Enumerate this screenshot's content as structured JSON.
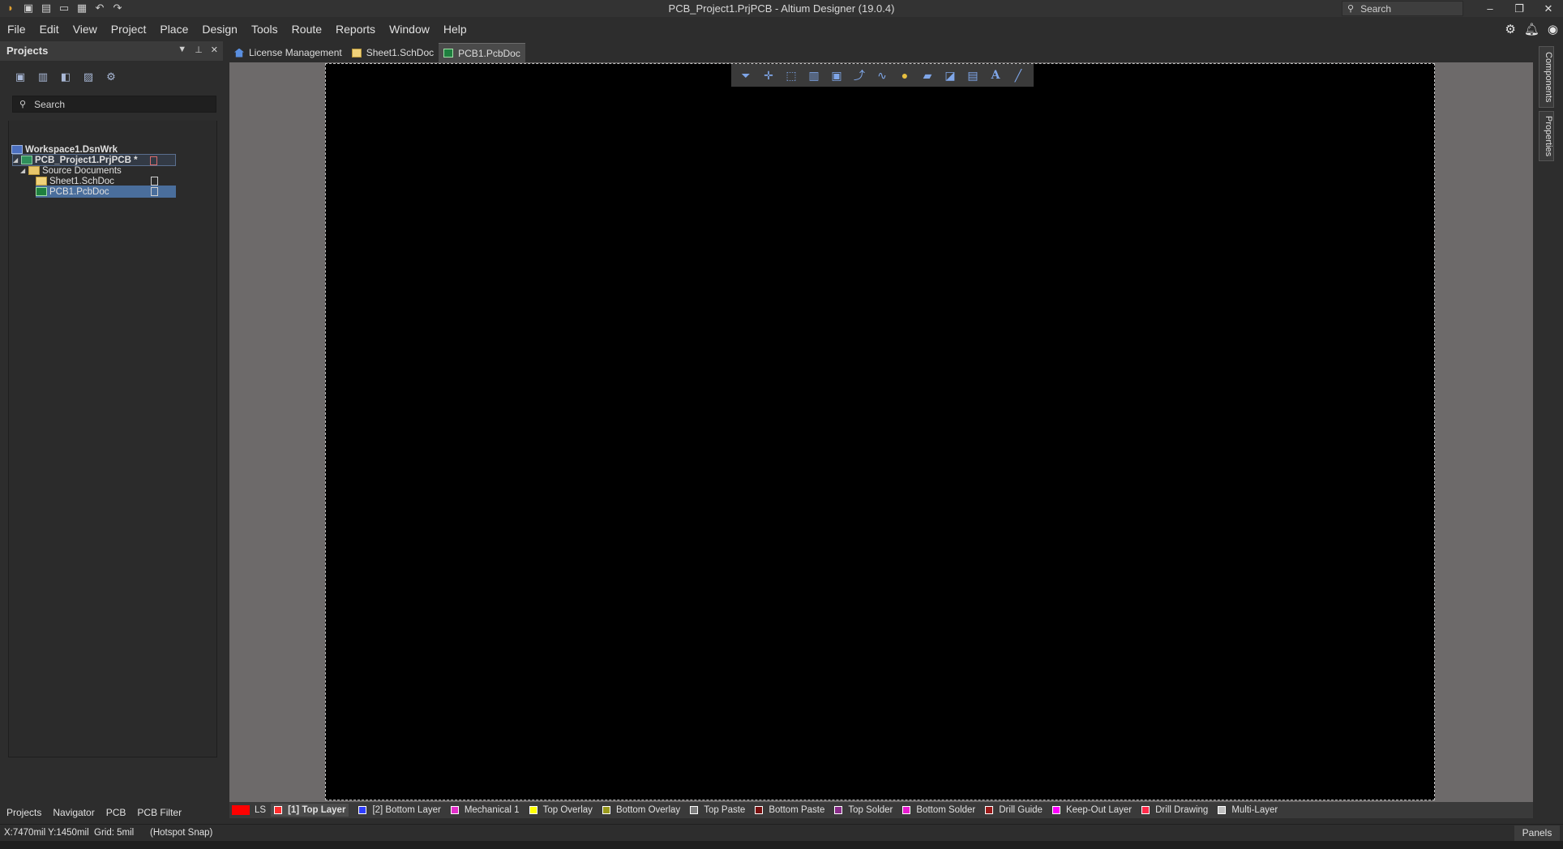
{
  "window": {
    "title": "PCB_Project1.PrjPCB - Altium Designer (19.0.4)",
    "search_label": "Search",
    "controls": [
      "–",
      "❐",
      "✕"
    ]
  },
  "menu": [
    "File",
    "Edit",
    "View",
    "Project",
    "Place",
    "Design",
    "Tools",
    "Route",
    "Reports",
    "Window",
    "Help"
  ],
  "projects_panel": {
    "title": "Projects",
    "search_placeholder": "Search",
    "tree": {
      "workspace": "Workspace1.DsnWrk",
      "project": "PCB_Project1.PrjPCB *",
      "folder": "Source Documents",
      "documents": [
        "Sheet1.SchDoc",
        "PCB1.PcbDoc"
      ]
    },
    "bottom_tabs": [
      "Projects",
      "Navigator",
      "PCB",
      "PCB Filter"
    ]
  },
  "doc_tabs": [
    {
      "label": "License Management",
      "icon": "home-icon"
    },
    {
      "label": "Sheet1.SchDoc",
      "icon": "schematic-doc-icon"
    },
    {
      "label": "PCB1.PcbDoc",
      "icon": "pcb-doc-icon",
      "active": true
    }
  ],
  "active_bar_tools": [
    "filter-icon",
    "cross-probe-icon",
    "select-area-icon",
    "align-icon",
    "component-icon",
    "route-icon",
    "interactive-route-icon",
    "pad-icon",
    "polygon-icon",
    "shape-icon",
    "dimension-icon",
    "text-icon",
    "line-icon"
  ],
  "right_dock": [
    "Components",
    "Properties"
  ],
  "layers": {
    "ls_label": "LS",
    "ls_color": "#ff0000",
    "items": [
      {
        "label": "[1] Top Layer",
        "color": "#ff2d2d",
        "active": true
      },
      {
        "label": "[2] Bottom Layer",
        "color": "#2f3dff"
      },
      {
        "label": "Mechanical 1",
        "color": "#e22fc9"
      },
      {
        "label": "Top Overlay",
        "color": "#ffff00"
      },
      {
        "label": "Bottom Overlay",
        "color": "#9a9a1e"
      },
      {
        "label": "Top Paste",
        "color": "#808080"
      },
      {
        "label": "Bottom Paste",
        "color": "#7a1010"
      },
      {
        "label": "Top Solder",
        "color": "#8a2c8a"
      },
      {
        "label": "Bottom Solder",
        "color": "#e81cd0"
      },
      {
        "label": "Drill Guide",
        "color": "#9b1a1a"
      },
      {
        "label": "Keep-Out Layer",
        "color": "#ff00ff"
      },
      {
        "label": "Drill Drawing",
        "color": "#ff2a4a"
      },
      {
        "label": "Multi-Layer",
        "color": "#c0c0c0"
      }
    ]
  },
  "status": {
    "coords": "X:7470mil Y:1450mil",
    "grid": "Grid: 5mil",
    "snap": "(Hotspot Snap)",
    "panels_button": "Panels"
  }
}
